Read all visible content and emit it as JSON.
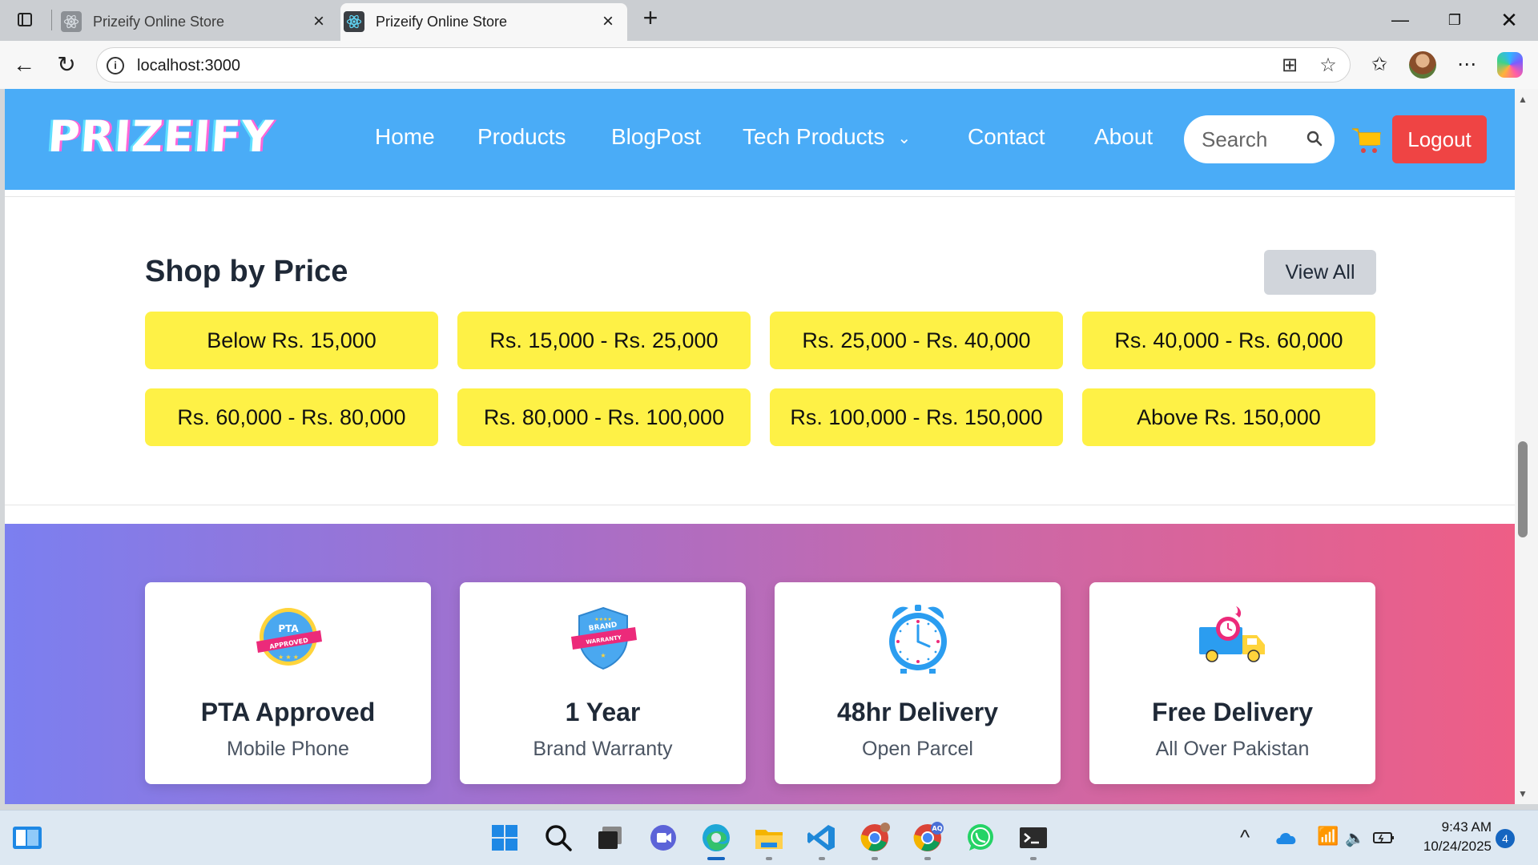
{
  "browser": {
    "tabs": [
      {
        "title": "Prizeify Online Store",
        "active": false
      },
      {
        "title": "Prizeify Online Store",
        "active": true
      }
    ],
    "url": "localhost:3000"
  },
  "header": {
    "logo": "PRIZEIFY",
    "nav": [
      "Home",
      "Products",
      "BlogPost",
      "Tech Products",
      "Contact",
      "About"
    ],
    "search_placeholder": "Search",
    "logout_label": "Logout"
  },
  "shop_by_price": {
    "title": "Shop by Price",
    "view_all_label": "View All",
    "ranges": [
      "Below Rs. 15,000",
      "Rs. 15,000 - Rs. 25,000",
      "Rs. 25,000 - Rs. 40,000",
      "Rs. 40,000 - Rs. 60,000",
      "Rs. 60,000 - Rs. 80,000",
      "Rs. 80,000 - Rs. 100,000",
      "Rs. 100,000 - Rs. 150,000",
      "Above Rs. 150,000"
    ]
  },
  "features": [
    {
      "title": "PTA Approved",
      "subtitle": "Mobile Phone",
      "icon": "pta-approved-badge-icon",
      "badge_lines": [
        "PTA",
        "APPROVED"
      ]
    },
    {
      "title": "1 Year",
      "subtitle": "Brand Warranty",
      "icon": "brand-warranty-shield-icon",
      "badge_lines": [
        "BRAND",
        "WARRANTY"
      ]
    },
    {
      "title": "48hr Delivery",
      "subtitle": "Open Parcel",
      "icon": "alarm-clock-icon"
    },
    {
      "title": "Free Delivery",
      "subtitle": "All Over Pakistan",
      "icon": "delivery-truck-icon"
    }
  ],
  "taskbar": {
    "time": "9:43 AM",
    "date": "10/24/2025",
    "notification_count": "4",
    "chrome_badge": "AQ"
  },
  "colors": {
    "header_bg": "#4aacf7",
    "price_btn_bg": "#fef146",
    "logout_bg": "#ef4444",
    "view_all_bg": "#d1d5db"
  }
}
